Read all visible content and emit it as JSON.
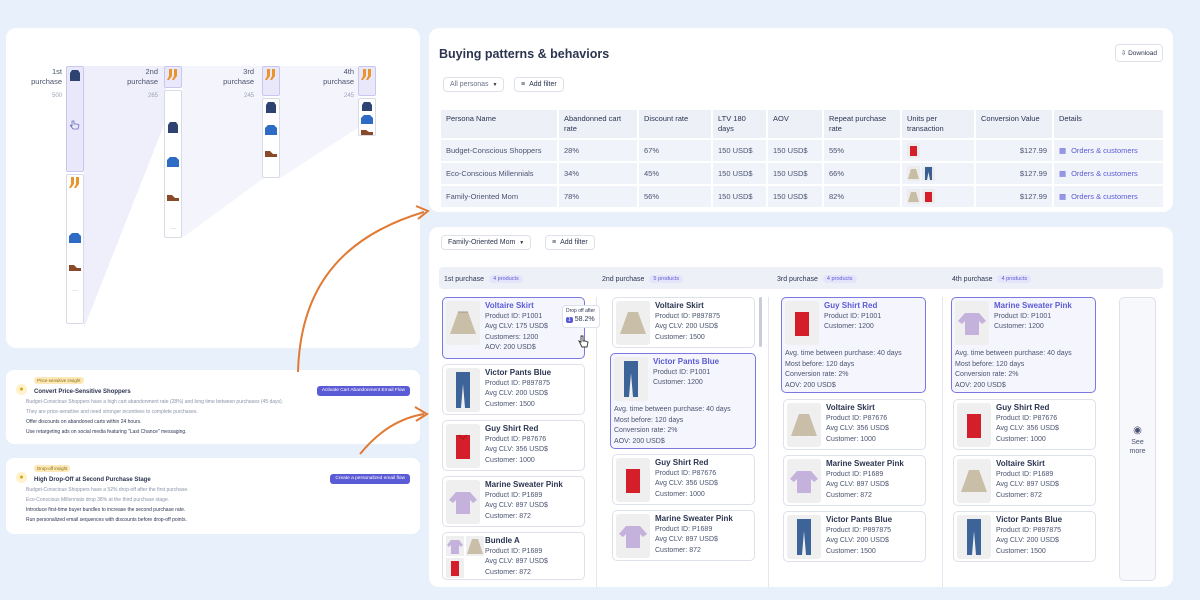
{
  "flow": {
    "columns": [
      {
        "title_a": "1st",
        "title_b": "purchase",
        "count": "500"
      },
      {
        "title_a": "2nd",
        "title_b": "purchase",
        "count": "265"
      },
      {
        "title_a": "3rd",
        "title_b": "purchase",
        "count": "245"
      },
      {
        "title_a": "4th",
        "title_b": "purchase",
        "count": "245"
      }
    ]
  },
  "insights": [
    {
      "tag": "Price-sensitive insight",
      "title": "Convert Price-Sensitive Shoppers",
      "action": "Activate Cart Abandonment Email Flow",
      "lines": [
        "Budget-Conscious Shoppers have a high cart abandonment rate (28%) and long time between purchases (45 days).",
        "They are price-sensitive and need stronger incentives to complete purchases."
      ],
      "tips": [
        "Offer discounts on abandoned carts within 24 hours.",
        "Use retargeting ads on social media featuring \"Last Chance\" messaging."
      ]
    },
    {
      "tag": "Drop-off insight",
      "title": "High Drop-Off at Second Purchase Stage",
      "action": "Create a personalized email flow",
      "lines": [
        "Budget-Conscious Shoppers have a 52% drop-off after the first purchase.",
        "Eco-Conscious Millennials drop 38% at the third purchase stage."
      ],
      "tips": [
        "Introduce first-time buyer bundles to increase the second purchase rate.",
        "Run personalized email sequences with discounts before drop-off points."
      ]
    }
  ],
  "patterns": {
    "title": "Buying patterns & behaviors",
    "download": "Download",
    "persona_filter": "All personas",
    "add_filter": "Add filter",
    "headers": [
      "Persona Name",
      "Abandonned cart rate",
      "Discount rate",
      "LTV 180 days",
      "AOV",
      "Repeat purchase rate",
      "Units per transaction",
      "Conversion Value",
      "Details"
    ],
    "rows": [
      {
        "persona": "Budget-Conscious Shoppers",
        "abandon": "28%",
        "discount": "67%",
        "ltv": "150 USD$",
        "aov": "150 USD$",
        "repeat": "55%",
        "conv": "$127.99",
        "details": "Orders & customers"
      },
      {
        "persona": "Eco-Conscious Millennials",
        "abandon": "34%",
        "discount": "45%",
        "ltv": "150 USD$",
        "aov": "150 USD$",
        "repeat": "66%",
        "conv": "$127.99",
        "details": "Orders & customers"
      },
      {
        "persona": "Family-Oriented Mom",
        "abandon": "78%",
        "discount": "56%",
        "ltv": "150 USD$",
        "aov": "150 USD$",
        "repeat": "82%",
        "conv": "$127.99",
        "details": "Orders & customers"
      }
    ]
  },
  "board": {
    "persona_filter": "Family-Oriented Mom",
    "add_filter": "Add filter",
    "see_more": "See more",
    "tooltip_label": "Drop off after",
    "tooltip_step": "1",
    "tooltip_value": "58.2%",
    "columns": [
      {
        "title": "1st purchase",
        "count": "4 products"
      },
      {
        "title": "2nd purchase",
        "count": "5 products"
      },
      {
        "title": "3rd purchase",
        "count": "4 products"
      },
      {
        "title": "4th purchase",
        "count": "4 products"
      }
    ],
    "labels": {
      "pid": "Product ID:",
      "clv": "Avg CLV:",
      "cust_a": "Customers:",
      "cust_b": "Customer:",
      "aov": "AOV:",
      "time": "Avg. time between purchase:",
      "before": "Most before:",
      "conv": "Conversion rate:"
    },
    "products": {
      "c1p1": {
        "name": "Voltaire Skirt",
        "pid": "P1001",
        "clv": "175 USD$",
        "cust": "1200",
        "aov": "200 USD$"
      },
      "c1p2": {
        "name": "Victor Pants Blue",
        "pid": "P897875",
        "clv": "200 USD$",
        "cust": "1500"
      },
      "c1p3": {
        "name": "Guy Shirt Red",
        "pid": "P87676",
        "clv": "356 USD$",
        "cust": "1000"
      },
      "c1p4": {
        "name": "Marine Sweater Pink",
        "pid": "P1689",
        "clv": "897 USD$",
        "cust": "872"
      },
      "c1p5": {
        "name": "Bundle A",
        "pid": "P1689",
        "clv": "897 USD$",
        "cust": "872"
      },
      "c2p1": {
        "name": "Voltaire Skirt",
        "pid": "P897875",
        "clv": "200 USD$",
        "cust": "1500"
      },
      "c2p2": {
        "name": "Victor Pants Blue",
        "pid": "P1001",
        "cust": "1200",
        "time": "40 days",
        "before": "120 days",
        "conv": "2%",
        "aov": "200 USD$"
      },
      "c2p3": {
        "name": "Guy Shirt Red",
        "pid": "P87676",
        "clv": "356 USD$",
        "cust": "1000"
      },
      "c2p4": {
        "name": "Marine Sweater Pink",
        "pid": "P1689",
        "clv": "897 USD$",
        "cust": "872"
      },
      "c3p1": {
        "name": "Guy Shirt Red",
        "pid": "P1001",
        "cust": "1200",
        "time": "40 days",
        "before": "120 days",
        "conv": "2%",
        "aov": "200 USD$"
      },
      "c3p2": {
        "name": "Voltaire Skirt",
        "pid": "P87676",
        "clv": "356 USD$",
        "cust": "1000"
      },
      "c3p3": {
        "name": "Marine Sweater Pink",
        "pid": "P1689",
        "clv": "897 USD$",
        "cust": "872"
      },
      "c3p4": {
        "name": "Victor Pants Blue",
        "pid": "P897875",
        "clv": "200 USD$",
        "cust": "1500"
      },
      "c4p1": {
        "name": "Marine Sweater Pink",
        "pid": "P1001",
        "cust": "1200",
        "time": "40 days",
        "before": "120 days",
        "conv": "2%",
        "aov": "200 USD$"
      },
      "c4p2": {
        "name": "Guy Shirt Red",
        "pid": "P87676",
        "clv": "356 USD$",
        "cust": "1000"
      },
      "c4p3": {
        "name": "Voltaire Skirt",
        "pid": "P1689",
        "clv": "897 USD$",
        "cust": "872"
      },
      "c4p4": {
        "name": "Victor Pants Blue",
        "pid": "P897875",
        "clv": "200 USD$",
        "cust": "1500"
      }
    }
  },
  "colors": {
    "accent": "#5b5bd6",
    "arrow": "#e07a34",
    "background": "#e8f1fb"
  }
}
